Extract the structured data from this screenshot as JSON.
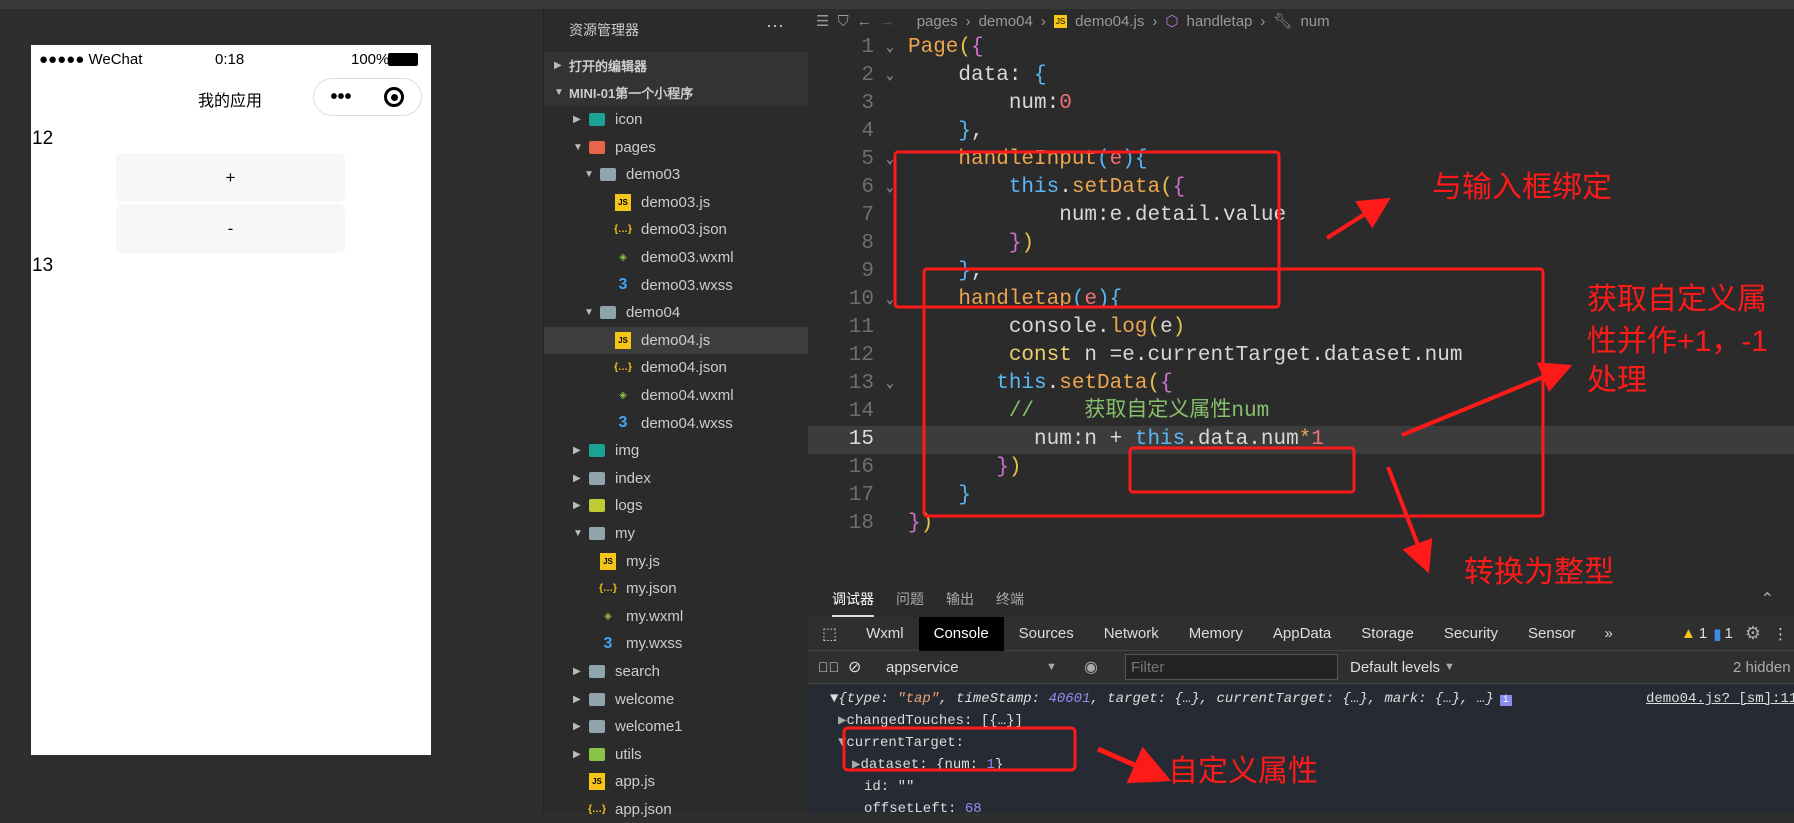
{
  "phone": {
    "carrier": "●●●●● WeChat",
    "time": "0:18",
    "battery": "100%",
    "title": "我的应用",
    "capsule_more": "•••",
    "value_top": "12",
    "plus_label": "+",
    "minus_label": "-",
    "value_bottom": "13"
  },
  "explorer": {
    "title": "资源管理器",
    "more": "···",
    "open_editors": "打开的编辑器",
    "project": "MINI-01第一个小程序",
    "items": [
      {
        "label": "icon",
        "level": 0,
        "kind": "folder",
        "open": false,
        "icon": "folder-image-icon",
        "color": "#1aa394"
      },
      {
        "label": "pages",
        "level": 0,
        "kind": "folder",
        "open": true,
        "icon": "folder-pages-icon",
        "color": "#e8644a"
      },
      {
        "label": "demo03",
        "level": 1,
        "kind": "folder",
        "open": true,
        "icon": "folder-open-icon",
        "color": "#90a4ae"
      },
      {
        "label": "demo03.js",
        "level": 2,
        "kind": "js",
        "icon": "js-file-icon",
        "color": "#f5c518"
      },
      {
        "label": "demo03.json",
        "level": 2,
        "kind": "json",
        "icon": "json-file-icon",
        "color": "#f5c518"
      },
      {
        "label": "demo03.wxml",
        "level": 2,
        "kind": "wxml",
        "icon": "wxml-file-icon",
        "color": "#8bc34a"
      },
      {
        "label": "demo03.wxss",
        "level": 2,
        "kind": "wxss",
        "icon": "css-file-icon",
        "color": "#42a5f5"
      },
      {
        "label": "demo04",
        "level": 1,
        "kind": "folder",
        "open": true,
        "icon": "folder-open-icon",
        "color": "#90a4ae"
      },
      {
        "label": "demo04.js",
        "level": 2,
        "kind": "js",
        "icon": "js-file-icon",
        "color": "#f5c518",
        "selected": true
      },
      {
        "label": "demo04.json",
        "level": 2,
        "kind": "json",
        "icon": "json-file-icon",
        "color": "#f5c518"
      },
      {
        "label": "demo04.wxml",
        "level": 2,
        "kind": "wxml",
        "icon": "wxml-file-icon",
        "color": "#8bc34a"
      },
      {
        "label": "demo04.wxss",
        "level": 2,
        "kind": "wxss",
        "icon": "css-file-icon",
        "color": "#42a5f5"
      },
      {
        "label": "img",
        "level": 0,
        "kind": "folder",
        "open": false,
        "icon": "folder-image-icon",
        "color": "#1aa394"
      },
      {
        "label": "index",
        "level": 0,
        "kind": "folder",
        "open": false,
        "icon": "folder-icon",
        "color": "#90a4ae"
      },
      {
        "label": "logs",
        "level": 0,
        "kind": "folder",
        "open": false,
        "icon": "folder-logs-icon",
        "color": "#c0ca33"
      },
      {
        "label": "my",
        "level": 0,
        "kind": "folder",
        "open": true,
        "icon": "folder-open-icon",
        "color": "#90a4ae"
      },
      {
        "label": "my.js",
        "level": 1,
        "kind": "js",
        "icon": "js-file-icon",
        "color": "#f5c518"
      },
      {
        "label": "my.json",
        "level": 1,
        "kind": "json",
        "icon": "json-file-icon",
        "color": "#f5c518"
      },
      {
        "label": "my.wxml",
        "level": 1,
        "kind": "wxml",
        "icon": "wxml-file-icon",
        "color": "#8bc34a"
      },
      {
        "label": "my.wxss",
        "level": 1,
        "kind": "wxss",
        "icon": "css-file-icon",
        "color": "#42a5f5"
      },
      {
        "label": "search",
        "level": 0,
        "kind": "folder",
        "open": false,
        "icon": "folder-icon",
        "color": "#90a4ae"
      },
      {
        "label": "welcome",
        "level": 0,
        "kind": "folder",
        "open": false,
        "icon": "folder-icon",
        "color": "#90a4ae"
      },
      {
        "label": "welcome1",
        "level": 0,
        "kind": "folder",
        "open": false,
        "icon": "folder-icon",
        "color": "#90a4ae"
      },
      {
        "label": "utils",
        "level": 0,
        "kind": "folder",
        "open": false,
        "icon": "folder-utils-icon",
        "color": "#8bc34a"
      },
      {
        "label": "app.js",
        "level": 0,
        "kind": "js",
        "icon": "js-file-icon",
        "color": "#f5c518"
      },
      {
        "label": "app.json",
        "level": 0,
        "kind": "json",
        "icon": "json-file-icon",
        "color": "#f5c518"
      }
    ]
  },
  "editor": {
    "breadcrumb": [
      "pages",
      "demo04",
      "demo04.js",
      "handletap",
      "num"
    ],
    "current_line": 15,
    "lines": [
      {
        "n": 1,
        "fold": true,
        "t": [
          [
            "Page",
            "fn"
          ],
          [
            "(",
            "br1"
          ],
          [
            "{",
            "br2"
          ]
        ]
      },
      {
        "n": 2,
        "fold": true,
        "t": [
          [
            "    data: ",
            "tx"
          ],
          [
            "{",
            "br3"
          ]
        ]
      },
      {
        "n": 3,
        "t": [
          [
            "        num:",
            "tx"
          ],
          [
            "0",
            "num"
          ]
        ]
      },
      {
        "n": 4,
        "t": [
          [
            "    ",
            "tx"
          ],
          [
            "}",
            "br3"
          ],
          [
            ",",
            "tx"
          ]
        ]
      },
      {
        "n": 5,
        "fold": true,
        "t": [
          [
            "    handleInput",
            "fn"
          ],
          [
            "(",
            "br3"
          ],
          [
            "e",
            "num"
          ],
          [
            ")",
            "br3"
          ],
          [
            "{",
            "br3"
          ]
        ]
      },
      {
        "n": 6,
        "fold": true,
        "t": [
          [
            "        this",
            "kw"
          ],
          [
            ".",
            "tx"
          ],
          [
            "setData",
            "fn"
          ],
          [
            "(",
            "br1"
          ],
          [
            "{",
            "br2"
          ]
        ]
      },
      {
        "n": 7,
        "t": [
          [
            "            num:e.detail.value",
            "tx"
          ]
        ]
      },
      {
        "n": 8,
        "t": [
          [
            "        ",
            "tx"
          ],
          [
            "}",
            "br2"
          ],
          [
            ")",
            "br1"
          ]
        ]
      },
      {
        "n": 9,
        "t": [
          [
            "    ",
            "tx"
          ],
          [
            "}",
            "br3"
          ],
          [
            ",",
            "tx"
          ]
        ]
      },
      {
        "n": 10,
        "fold": true,
        "t": [
          [
            "    handletap",
            "fn"
          ],
          [
            "(",
            "br3"
          ],
          [
            "e",
            "num"
          ],
          [
            ")",
            "br3"
          ],
          [
            "{",
            "br3"
          ]
        ]
      },
      {
        "n": 11,
        "t": [
          [
            "        console.",
            "tx"
          ],
          [
            "log",
            "fn"
          ],
          [
            "(",
            "br1"
          ],
          [
            "e",
            "tx"
          ],
          [
            ")",
            "br1"
          ]
        ]
      },
      {
        "n": 12,
        "t": [
          [
            "        const",
            "const"
          ],
          [
            " n =e.currentTarget.dataset.num",
            "tx"
          ]
        ]
      },
      {
        "n": 13,
        "fold": true,
        "t": [
          [
            "       this",
            "kw"
          ],
          [
            ".",
            "tx"
          ],
          [
            "setData",
            "fn"
          ],
          [
            "(",
            "br1"
          ],
          [
            "{",
            "br2"
          ]
        ]
      },
      {
        "n": 14,
        "t": [
          [
            "        //    获取自定义属性num",
            "cm"
          ]
        ]
      },
      {
        "n": 15,
        "t": [
          [
            "          num:n + ",
            "tx"
          ],
          [
            "this",
            "kw"
          ],
          [
            ".data.num",
            "tx"
          ],
          [
            "*",
            "fn"
          ],
          [
            "1",
            "num"
          ]
        ]
      },
      {
        "n": 16,
        "t": [
          [
            "       ",
            "tx"
          ],
          [
            "}",
            "br2"
          ],
          [
            ")",
            "br1"
          ]
        ]
      },
      {
        "n": 17,
        "t": [
          [
            "    ",
            "tx"
          ],
          [
            "}",
            "br3"
          ]
        ]
      },
      {
        "n": 18,
        "t": [
          [
            "}",
            "br2"
          ],
          [
            ")",
            "br1"
          ]
        ]
      }
    ]
  },
  "devtools": {
    "tabs": [
      "调试器",
      "问题",
      "输出",
      "终端"
    ],
    "panels": [
      "Wxml",
      "Console",
      "Sources",
      "Network",
      "Memory",
      "AppData",
      "Storage",
      "Security",
      "Sensor"
    ],
    "active_panel": "Console",
    "more": "»",
    "warnings": "1",
    "messages": "1",
    "context": "appservice",
    "filter_placeholder": "Filter",
    "levels": "Default levels",
    "hidden": "2 hidden",
    "log": {
      "source": "demo04.js? [sm]:11",
      "summary_pre": "{type: ",
      "type_val": "\"tap\"",
      "summary_mid": ", timeStamp: ",
      "ts_val": "40601",
      "summary_post": ", target: {…}, currentTarget: {…}, mark: {…}, …}",
      "changed": "changedTouches: [{…}]",
      "current": "currentTarget:",
      "dataset_pre": "dataset: {num: ",
      "dataset_val": "1",
      "dataset_post": "}",
      "id": "id: \"\"",
      "offset_pre": "offsetLeft: ",
      "offset_val": "68"
    }
  },
  "annotations": {
    "a1": "与输入框绑定",
    "a2": [
      "获取自定义属",
      "性并作+1，-1",
      "处理"
    ],
    "a3": "转换为整型",
    "a4": "自定义属性",
    "color": "#ff1a1a"
  }
}
